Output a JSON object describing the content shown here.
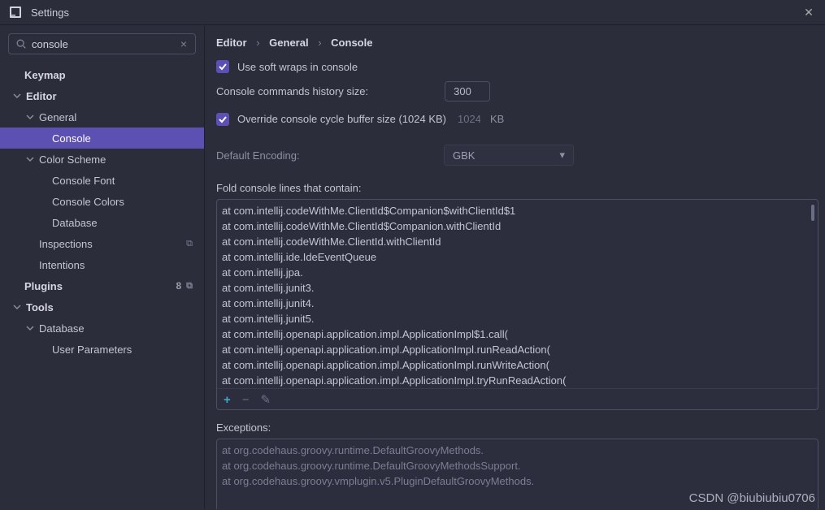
{
  "window": {
    "title": "Settings"
  },
  "search": {
    "value": "console",
    "placeholder": ""
  },
  "tree": {
    "keymap": "Keymap",
    "editor": "Editor",
    "general": "General",
    "console": "Console",
    "color_scheme": "Color Scheme",
    "console_font": "Console Font",
    "console_colors": "Console Colors",
    "database": "Database",
    "inspections": "Inspections",
    "intentions": "Intentions",
    "plugins": "Plugins",
    "plugins_badge": "8",
    "tools": "Tools",
    "tools_database": "Database",
    "user_parameters": "User Parameters"
  },
  "breadcrumbs": {
    "a": "Editor",
    "b": "General",
    "c": "Console"
  },
  "form": {
    "soft_wraps": "Use soft wraps in console",
    "history_label": "Console commands history size:",
    "history_value": "300",
    "override_label": "Override console cycle buffer size (1024 KB)",
    "override_value": "1024",
    "kb": "KB",
    "encoding_label": "Default Encoding:",
    "encoding_value": "GBK"
  },
  "fold": {
    "label": "Fold console lines that contain:",
    "items": [
      "at com.intellij.codeWithMe.ClientId$Companion$withClientId$1",
      "at com.intellij.codeWithMe.ClientId$Companion.withClientId",
      "at com.intellij.codeWithMe.ClientId.withClientId",
      "at com.intellij.ide.IdeEventQueue",
      "at com.intellij.jpa.",
      "at com.intellij.junit3.",
      "at com.intellij.junit4.",
      "at com.intellij.junit5.",
      "at com.intellij.openapi.application.impl.ApplicationImpl$1.call(",
      "at com.intellij.openapi.application.impl.ApplicationImpl.runReadAction(",
      "at com.intellij.openapi.application.impl.ApplicationImpl.runWriteAction(",
      "at com.intellij.openapi.application.impl.ApplicationImpl.tryRunReadAction("
    ]
  },
  "exceptions": {
    "label": "Exceptions:",
    "items": [
      "at org.codehaus.groovy.runtime.DefaultGroovyMethods.",
      "at org.codehaus.groovy.runtime.DefaultGroovyMethodsSupport.",
      "at org.codehaus.groovy.vmplugin.v5.PluginDefaultGroovyMethods."
    ]
  },
  "watermark": "CSDN @biubiubiu0706"
}
